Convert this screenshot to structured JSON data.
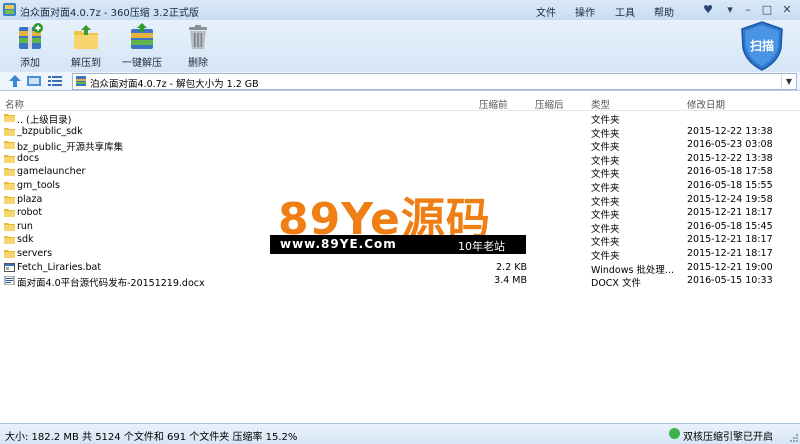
{
  "window": {
    "title": "泊众面对面4.0.7z - 360压缩 3.2正式版",
    "menu": [
      "文件",
      "操作",
      "工具",
      "帮助"
    ]
  },
  "toolbar": {
    "buttons": [
      "添加",
      "解压到",
      "一键解压",
      "删除"
    ],
    "scan_label": "扫描"
  },
  "address": {
    "path": "泊众面对面4.0.7z - 解包大小为 1.2 GB"
  },
  "columns": {
    "name": "名称",
    "compressed_before": "压缩前",
    "compressed_after": "压缩后",
    "type": "类型",
    "modified": "修改日期"
  },
  "files": [
    {
      "name": ".. (上级目录)",
      "size": "",
      "type": "文件夹",
      "date": "",
      "icon": "folder-icon"
    },
    {
      "name": "_bzpublic_sdk",
      "size": "",
      "type": "文件夹",
      "date": "2015-12-22 13:38",
      "icon": "folder-icon"
    },
    {
      "name": "bz_public_开源共享库集",
      "size": "",
      "type": "文件夹",
      "date": "2016-05-23 03:08",
      "icon": "folder-icon"
    },
    {
      "name": "docs",
      "size": "",
      "type": "文件夹",
      "date": "2015-12-22 13:38",
      "icon": "folder-icon"
    },
    {
      "name": "gamelauncher",
      "size": "",
      "type": "文件夹",
      "date": "2016-05-18 17:58",
      "icon": "folder-icon"
    },
    {
      "name": "gm_tools",
      "size": "",
      "type": "文件夹",
      "date": "2016-05-18 15:55",
      "icon": "folder-icon"
    },
    {
      "name": "plaza",
      "size": "",
      "type": "文件夹",
      "date": "2015-12-24 19:58",
      "icon": "folder-icon"
    },
    {
      "name": "robot",
      "size": "",
      "type": "文件夹",
      "date": "2015-12-21 18:17",
      "icon": "folder-icon"
    },
    {
      "name": "run",
      "size": "",
      "type": "文件夹",
      "date": "2016-05-18 15:45",
      "icon": "folder-icon"
    },
    {
      "name": "sdk",
      "size": "",
      "type": "文件夹",
      "date": "2015-12-21 18:17",
      "icon": "folder-icon"
    },
    {
      "name": "servers",
      "size": "",
      "type": "文件夹",
      "date": "2015-12-21 18:17",
      "icon": "folder-icon"
    },
    {
      "name": "Fetch_Liraries.bat",
      "size": "2.2 KB",
      "type": "Windows 批处理...",
      "date": "2015-12-21 19:00",
      "icon": "bat-file-icon"
    },
    {
      "name": "面对面4.0平台源代码发布-20151219.docx",
      "size": "3.4 MB",
      "type": "DOCX 文件",
      "date": "2016-05-15 10:33",
      "icon": "docx-file-icon"
    }
  ],
  "watermark": {
    "brand": "89Ye源码",
    "url": "www.89YE.Com",
    "site": "10年老站"
  },
  "status": {
    "summary": "大小: 182.2 MB 共 5124 个文件和 691 个文件夹 压缩率 15.2%",
    "engine": "双核压缩引擎已开启"
  }
}
